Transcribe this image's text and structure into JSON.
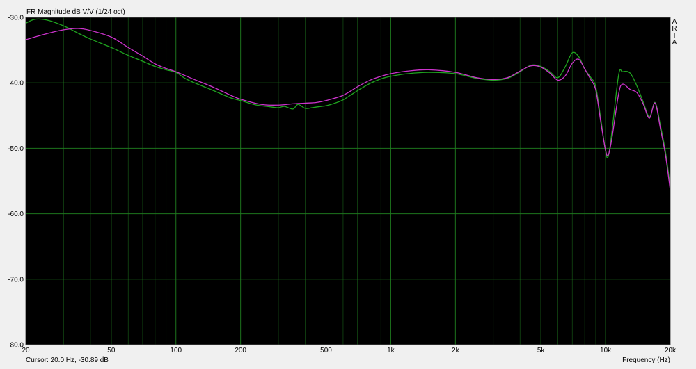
{
  "chart_data": {
    "type": "line",
    "title": "FR Magnitude dB V/V (1/24 oct)",
    "xlabel": "Frequency (Hz)",
    "ylabel": "",
    "x_scale": "log",
    "xlim": [
      20,
      20000
    ],
    "ylim": [
      -80,
      -30
    ],
    "grid": true,
    "x_ticks": [
      {
        "value": 20,
        "label": "20"
      },
      {
        "value": 50,
        "label": "50"
      },
      {
        "value": 100,
        "label": "100"
      },
      {
        "value": 200,
        "label": "200"
      },
      {
        "value": 500,
        "label": "500"
      },
      {
        "value": 1000,
        "label": "1k"
      },
      {
        "value": 2000,
        "label": "2k"
      },
      {
        "value": 5000,
        "label": "5k"
      },
      {
        "value": 10000,
        "label": "10k"
      },
      {
        "value": 20000,
        "label": "20k"
      }
    ],
    "y_ticks": [
      {
        "value": -30,
        "label": "-30.0"
      },
      {
        "value": -40,
        "label": "-40.0"
      },
      {
        "value": -50,
        "label": "-50.0"
      },
      {
        "value": -60,
        "label": "-60.0"
      },
      {
        "value": -70,
        "label": "-70.0"
      },
      {
        "value": -80,
        "label": "-80.0"
      }
    ],
    "watermark": [
      "A",
      "R",
      "T",
      "A"
    ],
    "cursor_readout": "Cursor: 20.0 Hz, -30.89 dB",
    "colors": {
      "background": "#000000",
      "grid": "#1f7a1f",
      "series_green": "#1fa31f",
      "series_magenta": "#cc33cc"
    },
    "series": [
      {
        "color": "#1fa31f",
        "points": [
          [
            20,
            -30.9
          ],
          [
            22,
            -30.3
          ],
          [
            25,
            -30.4
          ],
          [
            30,
            -31.3
          ],
          [
            35,
            -32.4
          ],
          [
            40,
            -33.3
          ],
          [
            50,
            -34.6
          ],
          [
            60,
            -35.8
          ],
          [
            70,
            -36.7
          ],
          [
            80,
            -37.5
          ],
          [
            90,
            -38.0
          ],
          [
            100,
            -38.4
          ],
          [
            110,
            -39.3
          ],
          [
            120,
            -39.9
          ],
          [
            150,
            -41.2
          ],
          [
            180,
            -42.3
          ],
          [
            200,
            -42.7
          ],
          [
            230,
            -43.3
          ],
          [
            250,
            -43.5
          ],
          [
            280,
            -43.7
          ],
          [
            300,
            -43.8
          ],
          [
            320,
            -43.6
          ],
          [
            350,
            -44.0
          ],
          [
            370,
            -43.3
          ],
          [
            400,
            -43.9
          ],
          [
            430,
            -43.8
          ],
          [
            450,
            -43.7
          ],
          [
            500,
            -43.5
          ],
          [
            550,
            -43.1
          ],
          [
            600,
            -42.6
          ],
          [
            700,
            -41.2
          ],
          [
            800,
            -40.1
          ],
          [
            900,
            -39.4
          ],
          [
            1000,
            -39.0
          ],
          [
            1200,
            -38.6
          ],
          [
            1500,
            -38.4
          ],
          [
            2000,
            -38.6
          ],
          [
            2500,
            -39.3
          ],
          [
            3000,
            -39.6
          ],
          [
            3500,
            -39.3
          ],
          [
            4000,
            -38.3
          ],
          [
            4500,
            -37.3
          ],
          [
            5000,
            -37.5
          ],
          [
            5500,
            -38.3
          ],
          [
            6000,
            -39.2
          ],
          [
            6500,
            -37.5
          ],
          [
            7000,
            -35.4
          ],
          [
            7500,
            -36.0
          ],
          [
            8000,
            -37.9
          ],
          [
            8500,
            -39.1
          ],
          [
            9000,
            -40.6
          ],
          [
            9500,
            -45.5
          ],
          [
            10000,
            -50.5
          ],
          [
            10300,
            -51.2
          ],
          [
            10700,
            -47.5
          ],
          [
            11500,
            -38.8
          ],
          [
            12000,
            -38.3
          ],
          [
            13000,
            -38.5
          ],
          [
            14000,
            -40.5
          ],
          [
            15000,
            -43.0
          ],
          [
            16000,
            -45.2
          ],
          [
            17000,
            -43.0
          ],
          [
            18000,
            -46.5
          ],
          [
            19000,
            -50.5
          ],
          [
            20000,
            -55.8
          ]
        ]
      },
      {
        "color": "#cc33cc",
        "points": [
          [
            20,
            -33.4
          ],
          [
            25,
            -32.5
          ],
          [
            30,
            -31.9
          ],
          [
            35,
            -31.7
          ],
          [
            40,
            -32.0
          ],
          [
            50,
            -33.0
          ],
          [
            60,
            -34.6
          ],
          [
            70,
            -35.9
          ],
          [
            80,
            -37.1
          ],
          [
            90,
            -37.8
          ],
          [
            100,
            -38.3
          ],
          [
            120,
            -39.4
          ],
          [
            150,
            -40.7
          ],
          [
            180,
            -41.9
          ],
          [
            200,
            -42.5
          ],
          [
            250,
            -43.3
          ],
          [
            300,
            -43.4
          ],
          [
            350,
            -43.2
          ],
          [
            400,
            -43.1
          ],
          [
            450,
            -43.0
          ],
          [
            500,
            -42.7
          ],
          [
            600,
            -41.9
          ],
          [
            700,
            -40.6
          ],
          [
            800,
            -39.6
          ],
          [
            900,
            -39.0
          ],
          [
            1000,
            -38.6
          ],
          [
            1200,
            -38.2
          ],
          [
            1500,
            -38.0
          ],
          [
            2000,
            -38.4
          ],
          [
            2500,
            -39.2
          ],
          [
            3000,
            -39.5
          ],
          [
            3500,
            -39.2
          ],
          [
            4000,
            -38.2
          ],
          [
            4500,
            -37.4
          ],
          [
            5000,
            -37.6
          ],
          [
            5500,
            -38.5
          ],
          [
            6000,
            -39.6
          ],
          [
            6500,
            -38.9
          ],
          [
            7000,
            -37.0
          ],
          [
            7500,
            -36.4
          ],
          [
            8000,
            -37.9
          ],
          [
            8500,
            -39.4
          ],
          [
            9000,
            -41.1
          ],
          [
            9500,
            -46.0
          ],
          [
            10000,
            -50.3
          ],
          [
            10300,
            -51.0
          ],
          [
            10700,
            -48.5
          ],
          [
            11500,
            -41.7
          ],
          [
            12000,
            -40.2
          ],
          [
            13000,
            -41.0
          ],
          [
            14000,
            -41.5
          ],
          [
            15000,
            -43.3
          ],
          [
            16000,
            -45.4
          ],
          [
            17000,
            -43.1
          ],
          [
            18000,
            -47.0
          ],
          [
            19000,
            -51.0
          ],
          [
            20000,
            -56.4
          ]
        ]
      }
    ]
  }
}
